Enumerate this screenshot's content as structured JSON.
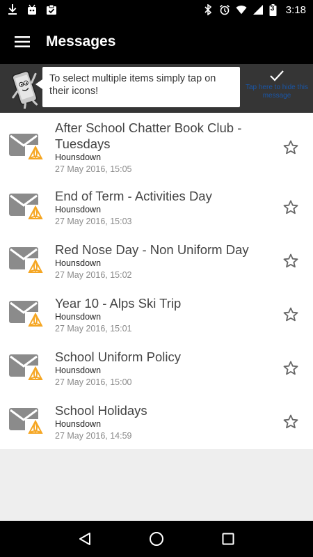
{
  "status_bar": {
    "time": "3:18",
    "battery_level": "3",
    "left_icons": [
      "download-icon",
      "android-icon",
      "clipboard-check-icon"
    ],
    "right_icons": [
      "bluetooth-icon",
      "alarm-icon",
      "wifi-icon",
      "cellular-icon",
      "battery-icon"
    ]
  },
  "toolbar": {
    "title": "Messages"
  },
  "hint": {
    "text": "To select multiple items simply tap on their icons!",
    "dismiss_label": "Tap here to hide this message"
  },
  "messages": [
    {
      "subject": "After School Chatter Book Club - Tuesdays",
      "sender": "Hounsdown",
      "date": "27 May 2016, 15:05"
    },
    {
      "subject": "End of Term - Activities Day",
      "sender": "Hounsdown",
      "date": "27 May 2016, 15:03"
    },
    {
      "subject": "Red Nose Day - Non Uniform Day",
      "sender": "Hounsdown",
      "date": "27 May 2016, 15:02"
    },
    {
      "subject": "Year 10 - Alps Ski Trip",
      "sender": "Hounsdown",
      "date": "27 May 2016, 15:01"
    },
    {
      "subject": "School Uniform Policy",
      "sender": "Hounsdown",
      "date": "27 May 2016, 15:00"
    },
    {
      "subject": "School Holidays",
      "sender": "Hounsdown",
      "date": "27 May 2016, 14:59"
    }
  ],
  "colors": {
    "bar_background": "#000000",
    "hint_background": "#353535",
    "dismiss_text": "#1a56a6",
    "logo_orange": "#f5a623"
  }
}
